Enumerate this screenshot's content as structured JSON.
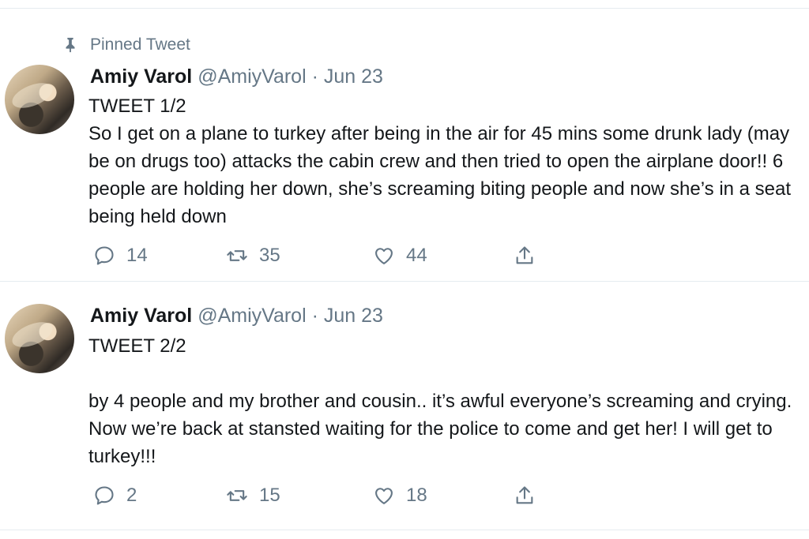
{
  "pinned_label": "Pinned Tweet",
  "tweets": [
    {
      "name": "Amiy Varol",
      "handle": "@AmiyVarol",
      "separator": "·",
      "date": "Jun 23",
      "text": "TWEET 1/2\nSo I get on a plane to turkey after being in the air for 45 mins some drunk lady (may be on drugs too) attacks the cabin crew and then tried to open the airplane door!! 6 people are holding her down, she’s screaming biting people and now she’s in a seat being held down",
      "replies": "14",
      "retweets": "35",
      "likes": "44"
    },
    {
      "name": "Amiy Varol",
      "handle": "@AmiyVarol",
      "separator": "·",
      "date": "Jun 23",
      "text": "TWEET 2/2\n\nby 4 people and my brother and cousin.. it’s awful everyone’s screaming and crying. Now we’re back at stansted waiting for the police to come and get her! I will get to turkey!!!",
      "replies": "2",
      "retweets": "15",
      "likes": "18"
    }
  ],
  "icons": {
    "pin": "pin-icon",
    "reply": "reply-icon",
    "retweet": "retweet-icon",
    "like": "heart-icon",
    "share": "share-icon"
  },
  "colors": {
    "text": "#14171a",
    "secondary": "#657786",
    "divider": "#e6ecf0"
  }
}
